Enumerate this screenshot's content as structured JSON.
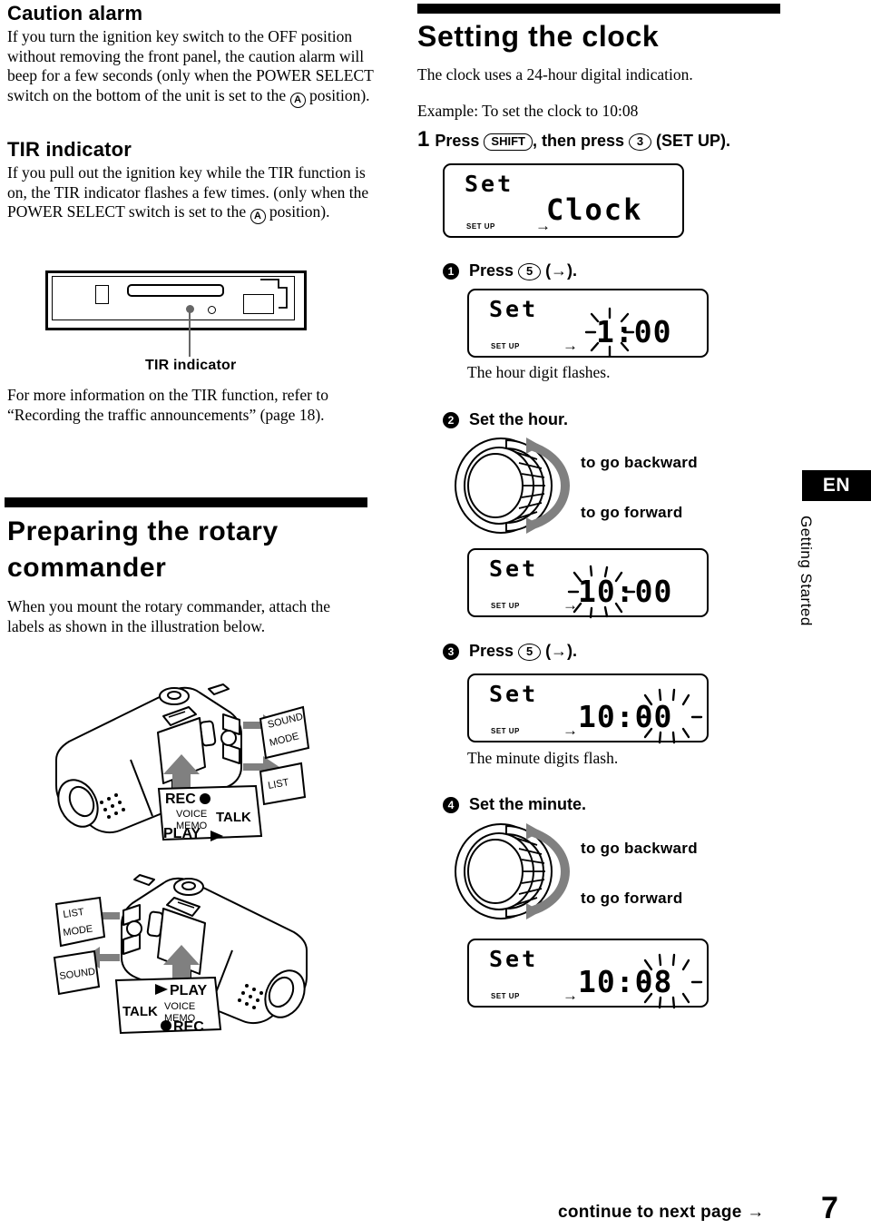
{
  "left_column": {
    "caution": {
      "heading": "Caution alarm",
      "body_before": "If you turn the ignition key switch to the OFF position without removing the front panel, the caution alarm will beep for a few seconds (only when the POWER SELECT switch on the bottom of the unit is set to the ",
      "circled_glyph": "A",
      "body_after": " position)."
    },
    "tir": {
      "heading": "TIR indicator",
      "body_before": "If you pull out the ignition key while the TIR function is on, the TIR indicator flashes a few times. (only when the POWER SELECT switch is set to the ",
      "circled_glyph": "A",
      "body_after": " position)."
    },
    "panel_callout": "TIR indicator",
    "tir_more_info": "For more information on the TIR function, refer to “Recording the traffic announcements” (page 18).",
    "rotary": {
      "heading_line1": "Preparing the rotary",
      "heading_line2": "commander",
      "body": "When you mount the rotary commander, attach the labels as shown in the illustration below."
    },
    "illustration_top_labels": {
      "sound": "SOUND",
      "mode": "MODE",
      "list": "LIST",
      "rec": "REC",
      "voice": "VOICE",
      "memo": "MEMO",
      "play": "PLAY",
      "talk": "TALK"
    },
    "illustration_bottom_labels": {
      "list": "LIST",
      "mode": "MODE",
      "sound": "SOUND",
      "play": "PLAY",
      "voice": "VOICE",
      "memo": "MEMO",
      "rec": "REC",
      "talk": "TALK"
    }
  },
  "right_column": {
    "heading": "Setting the clock",
    "intro": "The clock uses a 24-hour digital indication.",
    "example": "Example: To set the clock to 10:08",
    "steps": [
      {
        "number": "1",
        "bullet_style": "plain",
        "text_before": "Press ",
        "button1": "SHIFT",
        "button1_shape": "pill",
        "text_middle": ", then press ",
        "button2": "3",
        "button2_shape": "circle",
        "text_after": " (SET UP)."
      },
      {
        "number": "1",
        "bullet_style": "filled",
        "text_before": "Press ",
        "button1": "5",
        "button1_shape": "circle",
        "text_after": " (→)."
      },
      {
        "number": "2",
        "bullet_style": "filled",
        "text_before": "Set the hour."
      },
      {
        "number": "3",
        "bullet_style": "filled",
        "text_before": "Press ",
        "button1": "5",
        "button1_shape": "circle",
        "text_after": " (→)."
      },
      {
        "number": "4",
        "bullet_style": "filled",
        "text_before": "Set the minute."
      }
    ],
    "lcd_displays": [
      {
        "top_text": "Set",
        "main_text": "Clock",
        "indicator": "SET UP",
        "arrow": "→",
        "flashing": "none"
      },
      {
        "top_text": "Set",
        "main_text": "1:00",
        "indicator": "SET UP",
        "arrow": "→",
        "flashing": "hour"
      },
      {
        "top_text": "Set",
        "main_text": "10:00",
        "indicator": "SET UP",
        "arrow": "→",
        "flashing": "hour"
      },
      {
        "top_text": "Set",
        "main_text": "10:00",
        "indicator": "SET UP",
        "arrow": "→",
        "flashing": "minute"
      },
      {
        "top_text": "Set",
        "main_text": "10:08",
        "indicator": "SET UP",
        "arrow": "→",
        "flashing": "minute"
      }
    ],
    "captions": {
      "hour_flash": "The hour digit flashes.",
      "minute_flash": "The minute digits flash."
    },
    "knob_labels": {
      "backward": "to go backward",
      "forward": "to go forward"
    }
  },
  "side_tab": {
    "language": "EN",
    "section": "Getting Started"
  },
  "footer": {
    "continue_text": "continue to next page →",
    "page_number": "7"
  }
}
